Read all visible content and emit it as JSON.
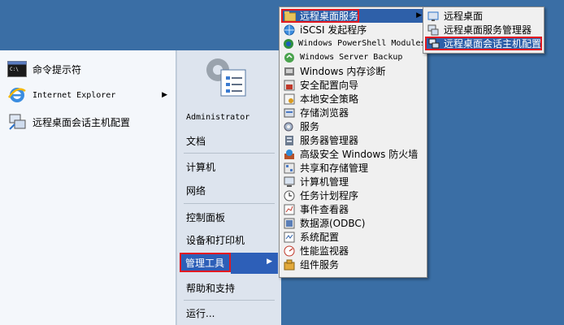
{
  "start_menu": {
    "pinned": [
      {
        "label": "命令提示符",
        "icon": "command-prompt-icon"
      },
      {
        "label": "Internet Explorer",
        "icon": "internet-explorer-icon",
        "has_submenu": true
      },
      {
        "label": "远程桌面会话主机配置",
        "icon": "remote-desktop-config-icon"
      }
    ],
    "right": {
      "user": "Administrator",
      "items": [
        "文档",
        "计算机",
        "网络",
        "控制面板",
        "设备和打印机",
        "管理工具",
        "帮助和支持",
        "运行..."
      ],
      "active": "管理工具"
    }
  },
  "admin_tools": {
    "items": [
      {
        "label": "远程桌面服务",
        "icon": "folder-icon"
      },
      {
        "label": "iSCSI 发起程序",
        "icon": "globe-icon"
      },
      {
        "label": "Windows PowerShell Modules",
        "icon": "powershell-icon"
      },
      {
        "label": "Windows Server Backup",
        "icon": "backup-icon"
      },
      {
        "label": "Windows 内存诊断",
        "icon": "memory-icon"
      },
      {
        "label": "安全配置向导",
        "icon": "security-wizard-icon"
      },
      {
        "label": "本地安全策略",
        "icon": "policy-icon"
      },
      {
        "label": "存储浏览器",
        "icon": "storage-icon"
      },
      {
        "label": "服务",
        "icon": "services-icon"
      },
      {
        "label": "服务器管理器",
        "icon": "server-manager-icon"
      },
      {
        "label": "高级安全 Windows 防火墙",
        "icon": "firewall-icon"
      },
      {
        "label": "共享和存储管理",
        "icon": "share-icon"
      },
      {
        "label": "计算机管理",
        "icon": "computer-management-icon"
      },
      {
        "label": "任务计划程序",
        "icon": "clock-icon"
      },
      {
        "label": "事件查看器",
        "icon": "event-viewer-icon"
      },
      {
        "label": "数据源(ODBC)",
        "icon": "odbc-icon"
      },
      {
        "label": "系统配置",
        "icon": "system-config-icon"
      },
      {
        "label": "性能监视器",
        "icon": "performance-icon"
      },
      {
        "label": "组件服务",
        "icon": "component-icon"
      }
    ]
  },
  "remote_desktop_submenu": {
    "items": [
      {
        "label": "远程桌面",
        "icon": "remote-desktop-icon"
      },
      {
        "label": "远程桌面服务管理器",
        "icon": "rds-manager-icon"
      },
      {
        "label": "远程桌面会话主机配置",
        "icon": "rd-session-host-icon"
      }
    ]
  }
}
